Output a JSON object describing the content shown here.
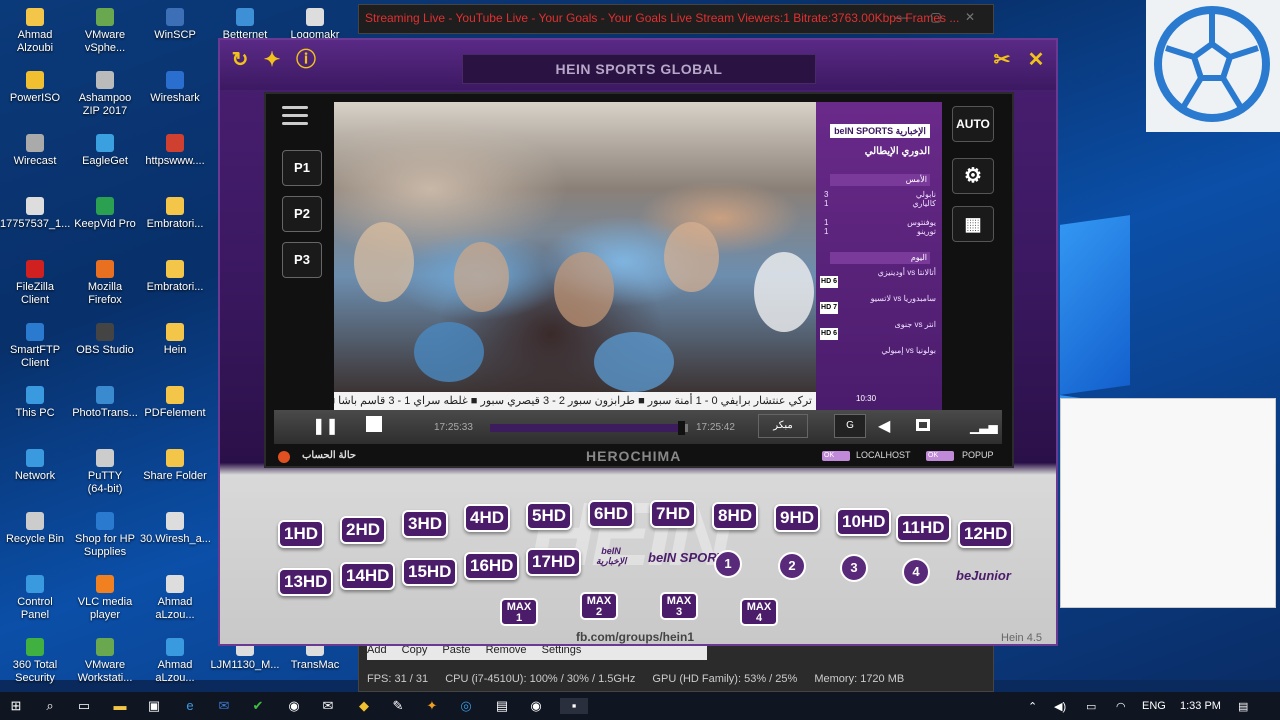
{
  "desktop": {
    "icons": [
      {
        "label": "Ahmad\nAlzoubi",
        "icon": "folder-icon",
        "color": "#f3c64a"
      },
      {
        "label": "VMware\nvSphe...",
        "icon": "vmware-icon",
        "color": "#6aa84f"
      },
      {
        "label": "WinSCP",
        "icon": "winscp-icon",
        "color": "#3d6fb6"
      },
      {
        "label": "Betternet",
        "icon": "betternet-icon",
        "color": "#3d8fd6"
      },
      {
        "label": "Logomakr",
        "icon": "document-icon",
        "color": "#dddddd"
      },
      {
        "label": "PowerISO",
        "icon": "poweriso-icon",
        "color": "#f0c030"
      },
      {
        "label": "Ashampoo\nZIP 2017",
        "icon": "zip-icon",
        "color": "#bbbbbb"
      },
      {
        "label": "Wireshark",
        "icon": "wireshark-icon",
        "color": "#2a6fd0"
      },
      {
        "label": "Wirecast",
        "icon": "wirecast-icon",
        "color": "#aaaaaa"
      },
      {
        "label": "EagleGet",
        "icon": "eagleget-icon",
        "color": "#3aa0e0"
      },
      {
        "label": "httpswww....",
        "icon": "chrome-icon",
        "color": "#d04030"
      },
      {
        "label": "17757537_1...",
        "icon": "document-icon",
        "color": "#dddddd"
      },
      {
        "label": "KeepVid Pro",
        "icon": "keepvid-icon",
        "color": "#2aa050"
      },
      {
        "label": "Embratori...",
        "icon": "folder-icon",
        "color": "#f3c64a"
      },
      {
        "label": "FileZilla\nClient",
        "icon": "filezilla-icon",
        "color": "#d02020"
      },
      {
        "label": "Mozilla\nFirefox",
        "icon": "firefox-icon",
        "color": "#e87020"
      },
      {
        "label": "Embratori...",
        "icon": "folder-icon",
        "color": "#f3c64a"
      },
      {
        "label": "SmartFTP\nClient",
        "icon": "smartftp-icon",
        "color": "#2a7ad0"
      },
      {
        "label": "OBS Studio",
        "icon": "obs-icon",
        "color": "#444444"
      },
      {
        "label": "Hein",
        "icon": "folder-icon",
        "color": "#f3c64a"
      },
      {
        "label": "This PC",
        "icon": "computer-icon",
        "color": "#3a9ae0"
      },
      {
        "label": "PhotoTrans...",
        "icon": "phototrans-icon",
        "color": "#3a8ad0"
      },
      {
        "label": "PDFelement",
        "icon": "folder-icon",
        "color": "#f3c64a"
      },
      {
        "label": "Network",
        "icon": "network-icon",
        "color": "#3a9ae0"
      },
      {
        "label": "PuTTY\n(64-bit)",
        "icon": "putty-icon",
        "color": "#cccccc"
      },
      {
        "label": "Share Folder",
        "icon": "folder-icon",
        "color": "#f3c64a"
      },
      {
        "label": "Recycle Bin",
        "icon": "recycle-bin-icon",
        "color": "#cccccc"
      },
      {
        "label": "Shop for HP\nSupplies",
        "icon": "hp-icon",
        "color": "#2a7ad0"
      },
      {
        "label": "30.Wiresh_a...",
        "icon": "document-icon",
        "color": "#dddddd"
      },
      {
        "label": "Control\nPanel",
        "icon": "control-panel-icon",
        "color": "#3a9ae0"
      },
      {
        "label": "VLC media\nplayer",
        "icon": "vlc-icon",
        "color": "#f08020"
      },
      {
        "label": "Ahmad\naLzou...",
        "icon": "document-icon",
        "color": "#dddddd"
      },
      {
        "label": "360 Total\nSecurity",
        "icon": "security-icon",
        "color": "#40b040"
      },
      {
        "label": "VMware\nWorkstati...",
        "icon": "vmware-icon",
        "color": "#6aa84f"
      },
      {
        "label": "Ahmad\naLzou...",
        "icon": "document-icon",
        "color": "#3a9ae0"
      },
      {
        "label": "LJM1130_M...",
        "icon": "document-icon",
        "color": "#dddddd"
      },
      {
        "label": "TransMac",
        "icon": "transmac-icon",
        "color": "#dddddd"
      }
    ]
  },
  "bg_window": {
    "title": "Streaming Live - YouTube Live - Your Goals - Your Goals Live Stream  Viewers:1  Bitrate:3763.00Kbps  Frames ...",
    "toolbar": [
      "Add",
      "Copy",
      "Paste",
      "Remove",
      "Settings"
    ],
    "stats": {
      "fps": "FPS:  31 / 31",
      "cpu": "CPU (i7-4510U): 100% / 30% / 1.5GHz",
      "gpu": "GPU (HD Family): 53% / 25%",
      "memory": "Memory:  1720 MB"
    }
  },
  "app": {
    "title": "HEIN SPORTS GLOBAL",
    "preset_buttons": [
      "P1",
      "P2",
      "P3"
    ],
    "right_buttons": {
      "auto": "AUTO"
    },
    "ticker": "تركي  عنتشار برايفي 0 - 1 أمنة سبور  ■  طرابزون سبور 2 - 3 قيصري سبور  ■  غلطه سراي 1 - 3 قاسم باشا  ■  كو",
    "sidebar": {
      "logo": "beIN SPORTS الإخبارية",
      "league": "الدوري الإيطالي",
      "yesterday_header": "الأمس",
      "results": [
        {
          "teams": "نابولي\nكالياري",
          "score": "3\n1"
        },
        {
          "teams": "يوفنتوس\nتورينو",
          "score": "1\n1"
        }
      ],
      "today_header": "اليوم",
      "fixtures": [
        {
          "badge": "HD 6",
          "match": "أودينيزي  vs  أتالانتا"
        },
        {
          "badge": "HD 7",
          "match": "لاتسيو  vs  سامبدوريا"
        },
        {
          "badge": "HD 6",
          "match": "جنوى  vs  انتر"
        },
        {
          "badge": "",
          "match": "إمبولي  vs  بولونيا"
        }
      ],
      "time": "10:30"
    },
    "controls": {
      "time_elapsed": "17:25:33",
      "time_total": "17:25:42",
      "early_label": "مبكر",
      "quality": "G",
      "progress": 0.97
    },
    "status": {
      "account": "حالة الحساب",
      "brand": "HEROCHIMA",
      "localhost_toggle": "OK",
      "localhost_label": "LOCALHOST",
      "popup_toggle": "OK",
      "popup_label": "POPUP"
    },
    "channels_row1": [
      "1HD",
      "2HD",
      "3HD",
      "4HD",
      "5HD",
      "6HD",
      "7HD",
      "8HD",
      "9HD",
      "10HD",
      "11HD",
      "12HD"
    ],
    "channels_row2": [
      "13HD",
      "14HD",
      "15HD",
      "16HD",
      "17HD"
    ],
    "logo_channels": [
      "beIN الإخبارية",
      "beIN SPORTS"
    ],
    "numbered_channels": [
      "1",
      "2",
      "3",
      "4"
    ],
    "junior": "beJunior",
    "max_channels": [
      "MAX\n1",
      "MAX\n2",
      "MAX\n3",
      "MAX\n4"
    ],
    "watermark": "HEIN",
    "fb_link": "fb.com/groups/hein1",
    "version": "Hein 4.5"
  },
  "taskbar": {
    "language": "ENG",
    "time": "1:33 PM"
  }
}
